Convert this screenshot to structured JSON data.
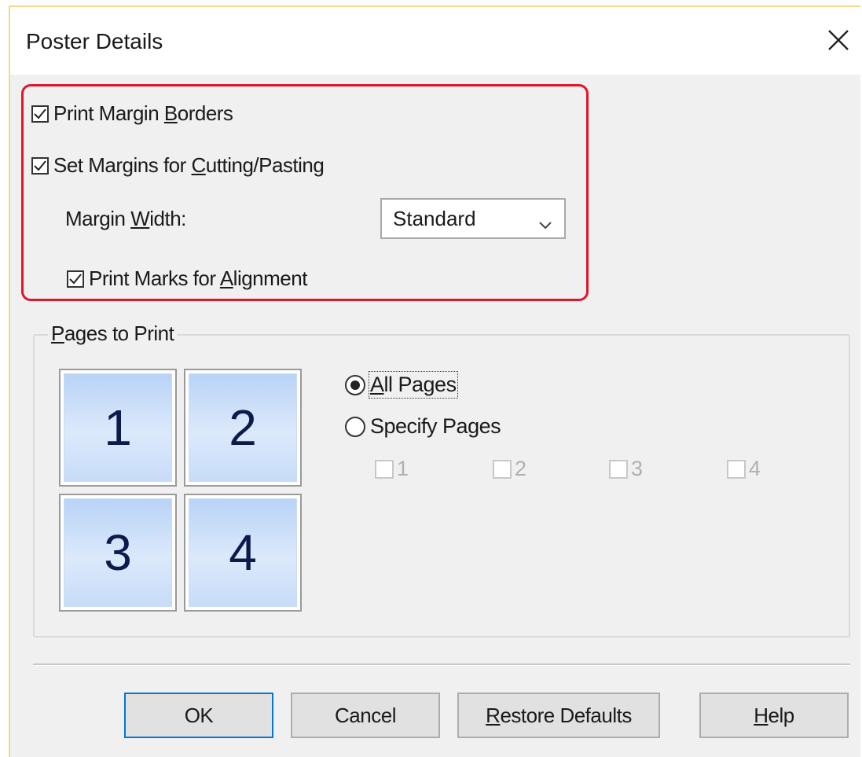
{
  "dialog": {
    "title": "Poster Details",
    "close_icon": "close-icon"
  },
  "options": {
    "print_margin_borders": {
      "pre": "Print Margin ",
      "hot": "B",
      "post": "orders",
      "checked": true
    },
    "set_margins": {
      "pre": "Set Margins for ",
      "hot": "C",
      "post": "utting/Pasting",
      "checked": true
    },
    "margin_width_label": {
      "pre": "Margin ",
      "hot": "W",
      "post": "idth:"
    },
    "margin_width_value": "Standard",
    "print_marks": {
      "pre": "Print Marks for ",
      "hot": "A",
      "post": "lignment",
      "checked": true
    }
  },
  "pages_group": {
    "label_hot": "P",
    "label_rest": "ages to Print",
    "tiles": [
      "1",
      "2",
      "3",
      "4"
    ],
    "all_pages": {
      "hot": "A",
      "rest": "ll Pages",
      "selected": true
    },
    "specify_pages": {
      "label": "Specify Pages",
      "selected": false
    },
    "page_checkboxes": [
      "1",
      "2",
      "3",
      "4"
    ]
  },
  "buttons": {
    "ok": "OK",
    "cancel": "Cancel",
    "restore_hot": "R",
    "restore_rest": "estore Defaults",
    "help_hot": "H",
    "help_rest": "elp"
  },
  "colors": {
    "highlight_border": "#e0162b",
    "default_button_border": "#0078d7",
    "tile_blue": "#b9d3f6"
  }
}
